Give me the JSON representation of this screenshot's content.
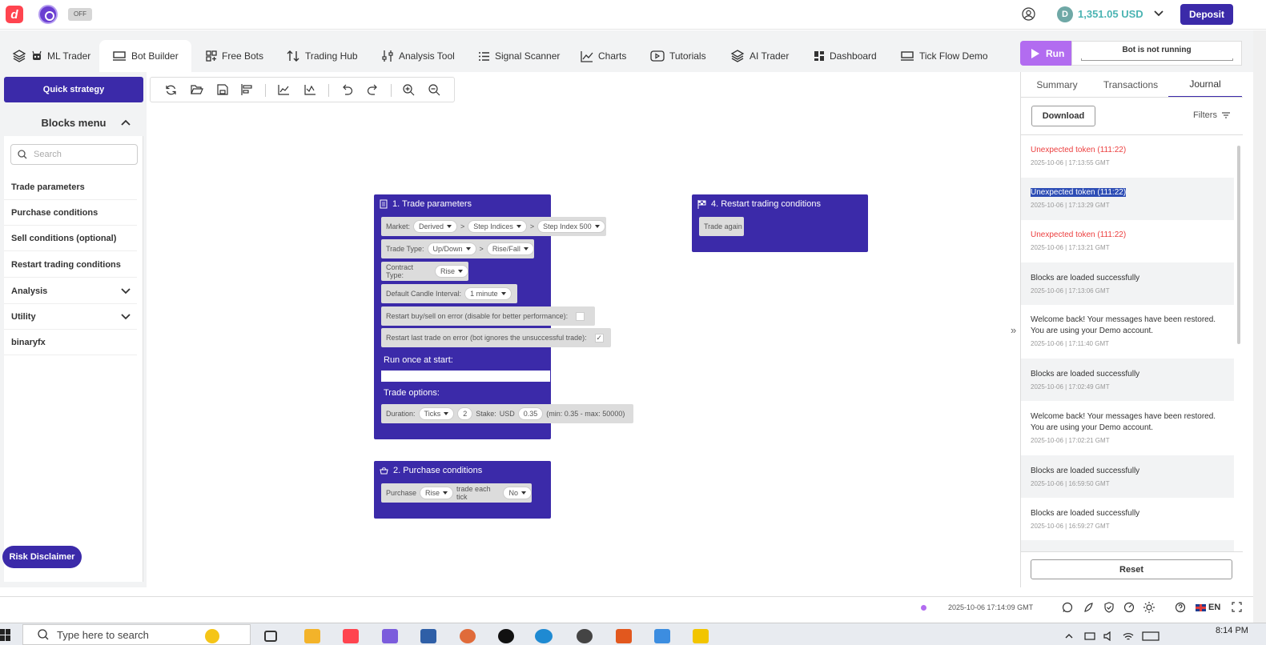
{
  "header": {
    "logo_letter": "d",
    "toggle_label": "OFF",
    "balance": "1,351.05 USD",
    "balance_icon": "D",
    "deposit_label": "Deposit"
  },
  "nav": {
    "tabs": [
      {
        "label": "ML Trader",
        "icon": "layers-icon"
      },
      {
        "label": "Bot Builder",
        "icon": "builder-icon"
      },
      {
        "label": "Free Bots",
        "icon": "grid-icon"
      },
      {
        "label": "Trading Hub",
        "icon": "arrows-icon"
      },
      {
        "label": "Analysis Tool",
        "icon": "sliders-icon"
      },
      {
        "label": "Signal Scanner",
        "icon": "list-icon"
      },
      {
        "label": "Charts",
        "icon": "chart-icon"
      },
      {
        "label": "Tutorials",
        "icon": "play-icon"
      },
      {
        "label": "AI Trader",
        "icon": "layers-icon"
      },
      {
        "label": "Dashboard",
        "icon": "dashboard-icon"
      },
      {
        "label": "Tick Flow Demo",
        "icon": "builder-icon"
      }
    ],
    "active_tab": "Bot Builder"
  },
  "run": {
    "button_label": "Run",
    "status": "Bot is not running"
  },
  "left": {
    "quick_strategy": "Quick strategy",
    "blocks_menu_title": "Blocks menu",
    "search_placeholder": "Search",
    "items": [
      {
        "label": "Trade parameters"
      },
      {
        "label": "Purchase conditions"
      },
      {
        "label": "Sell conditions (optional)"
      },
      {
        "label": "Restart trading conditions"
      },
      {
        "label": "Analysis"
      },
      {
        "label": "Utility"
      },
      {
        "label": "binaryfx"
      }
    ],
    "risk_disclaimer": "Risk Disclaimer"
  },
  "blocks": {
    "trade_params": {
      "title": "1. Trade parameters",
      "market_label": "Market:",
      "market": "Derived",
      "submarket": "Step Indices",
      "symbol": "Step Index 500",
      "trade_type_label": "Trade Type:",
      "trade_type": "Up/Down",
      "trade_subtype": "Rise/Fall",
      "contract_type_label": "Contract Type:",
      "contract_type": "Rise",
      "candle_label": "Default Candle Interval:",
      "candle_interval": "1 minute",
      "restart_buysell_label": "Restart buy/sell on error (disable for better performance):",
      "restart_last_label": "Restart last trade on error (bot ignores the unsuccessful trade):",
      "restart_last_check": "✓",
      "run_once_label": "Run once at start:",
      "trade_options_label": "Trade options:",
      "duration_label": "Duration:",
      "duration_unit": "Ticks",
      "duration_value": "2",
      "stake_label": "Stake:",
      "currency": "USD",
      "stake_value": "0.35",
      "stake_limits": "(min: 0.35 - max: 50000)"
    },
    "purchase": {
      "title": "2. Purchase conditions",
      "purchase_label": "Purchase",
      "purchase_value": "Rise",
      "each_tick_label": "trade each tick",
      "each_tick_value": "No"
    },
    "restart": {
      "title": "4. Restart trading conditions",
      "trade_again": "Trade again"
    }
  },
  "journal": {
    "tabs": [
      "Summary",
      "Transactions",
      "Journal"
    ],
    "download": "Download",
    "filters": "Filters",
    "entries": [
      {
        "message": "Unexpected token (111:22)",
        "time": "2025-10-06 | 17:13:55 GMT",
        "type": "error"
      },
      {
        "message": "Unexpected token (111:22)",
        "time": "2025-10-06 | 17:13:29 GMT",
        "type": "selected"
      },
      {
        "message": "Unexpected token (111:22)",
        "time": "2025-10-06 | 17:13:21 GMT",
        "type": "error"
      },
      {
        "message": "Blocks are loaded successfully",
        "time": "2025-10-06 | 17:13:06 GMT",
        "type": "info"
      },
      {
        "message": "Welcome back! Your messages have been restored. You are using your Demo account.",
        "time": "2025-10-06 | 17:11:40 GMT",
        "type": "info"
      },
      {
        "message": "Blocks are loaded successfully",
        "time": "2025-10-06 | 17:02:49 GMT",
        "type": "info"
      },
      {
        "message": "Welcome back! Your messages have been restored. You are using your Demo account.",
        "time": "2025-10-06 | 17:02:21 GMT",
        "type": "info"
      },
      {
        "message": "Blocks are loaded successfully",
        "time": "2025-10-06 | 16:59:50 GMT",
        "type": "info"
      },
      {
        "message": "Blocks are loaded successfully",
        "time": "2025-10-06 | 16:59:27 GMT",
        "type": "info"
      }
    ],
    "reset": "Reset"
  },
  "footer": {
    "server_time": "2025-10-06 17:14:09 GMT",
    "language": "EN"
  },
  "taskbar": {
    "search_placeholder": "Type here to search",
    "clock": "8:14 PM"
  },
  "colors": {
    "primary": "#3b2aa9",
    "run": "#b26cf0",
    "balance": "#4bb4b3",
    "error": "#ec3f3f"
  }
}
